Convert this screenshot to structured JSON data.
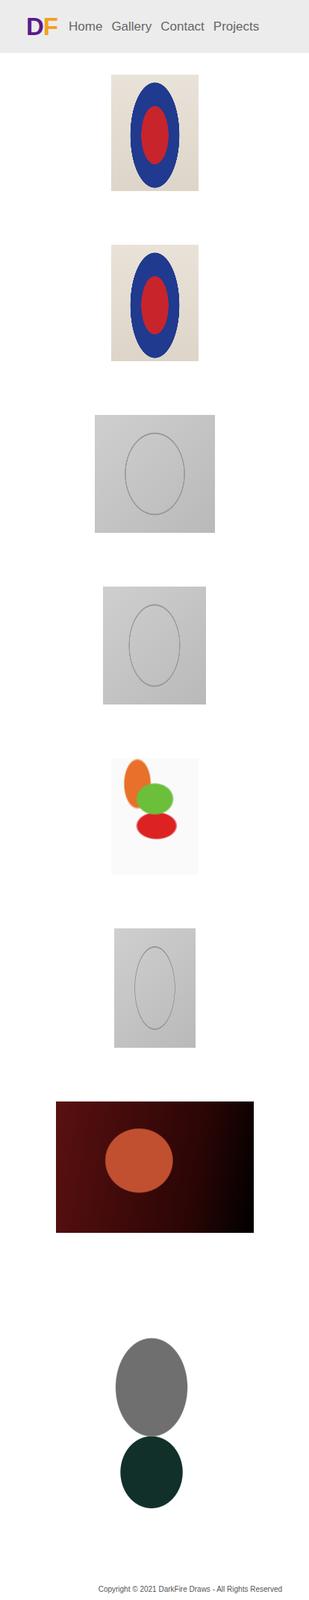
{
  "logo": {
    "letters": [
      {
        "text": "D",
        "color": "#5a1a8c"
      },
      {
        "text": "F",
        "color": "#f2a020"
      }
    ]
  },
  "nav": [
    {
      "label": "Home",
      "selected": false
    },
    {
      "label": "Gallery",
      "selected": false
    },
    {
      "label": "Contact",
      "selected": false
    },
    {
      "label": "Projects",
      "selected": false
    }
  ],
  "gallery": [
    {
      "kind": "portrait"
    },
    {
      "kind": "portrait"
    },
    {
      "kind": "sketch"
    },
    {
      "kind": "sketch"
    },
    {
      "kind": "action"
    },
    {
      "kind": "sketch"
    },
    {
      "kind": "scene"
    },
    {
      "kind": "cutout"
    }
  ],
  "footer": "Copyright © 2021 DarkFire Draws - All Rights Reserved"
}
